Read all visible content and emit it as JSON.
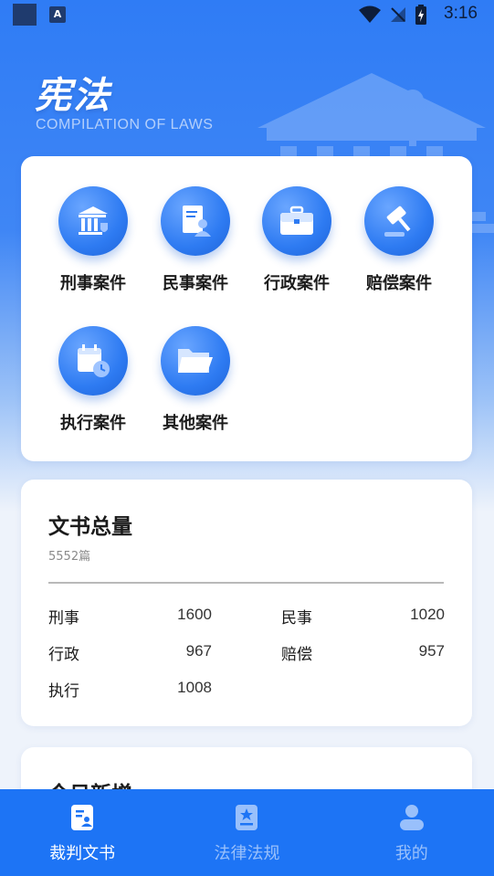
{
  "status_bar": {
    "time": "3:16",
    "app_badge": "A"
  },
  "header": {
    "title": "宪法",
    "subtitle": "COMPILATION OF LAWS"
  },
  "categories": [
    {
      "label": "刑事案件",
      "icon": "courthouse-icon"
    },
    {
      "label": "民事案件",
      "icon": "document-person-icon"
    },
    {
      "label": "行政案件",
      "icon": "briefcase-icon"
    },
    {
      "label": "赔偿案件",
      "icon": "gavel-icon"
    },
    {
      "label": "执行案件",
      "icon": "calendar-clock-icon"
    },
    {
      "label": "其他案件",
      "icon": "folder-icon"
    }
  ],
  "stats": {
    "title": "文书总量",
    "total": "5552篇",
    "items": [
      {
        "name": "刑事",
        "value": "1600"
      },
      {
        "name": "民事",
        "value": "1020"
      },
      {
        "name": "行政",
        "value": "967"
      },
      {
        "name": "赔偿",
        "value": "957"
      },
      {
        "name": "执行",
        "value": "1008"
      }
    ]
  },
  "new_today": {
    "title": "今日新增"
  },
  "tabs": [
    {
      "label": "裁判文书",
      "icon": "judgment-doc-icon",
      "active": true
    },
    {
      "label": "法律法规",
      "icon": "law-book-icon",
      "active": false
    },
    {
      "label": "我的",
      "icon": "user-icon",
      "active": false
    }
  ],
  "colors": {
    "primary": "#1d74f5",
    "card": "#ffffff",
    "background": "#eef3fb"
  }
}
